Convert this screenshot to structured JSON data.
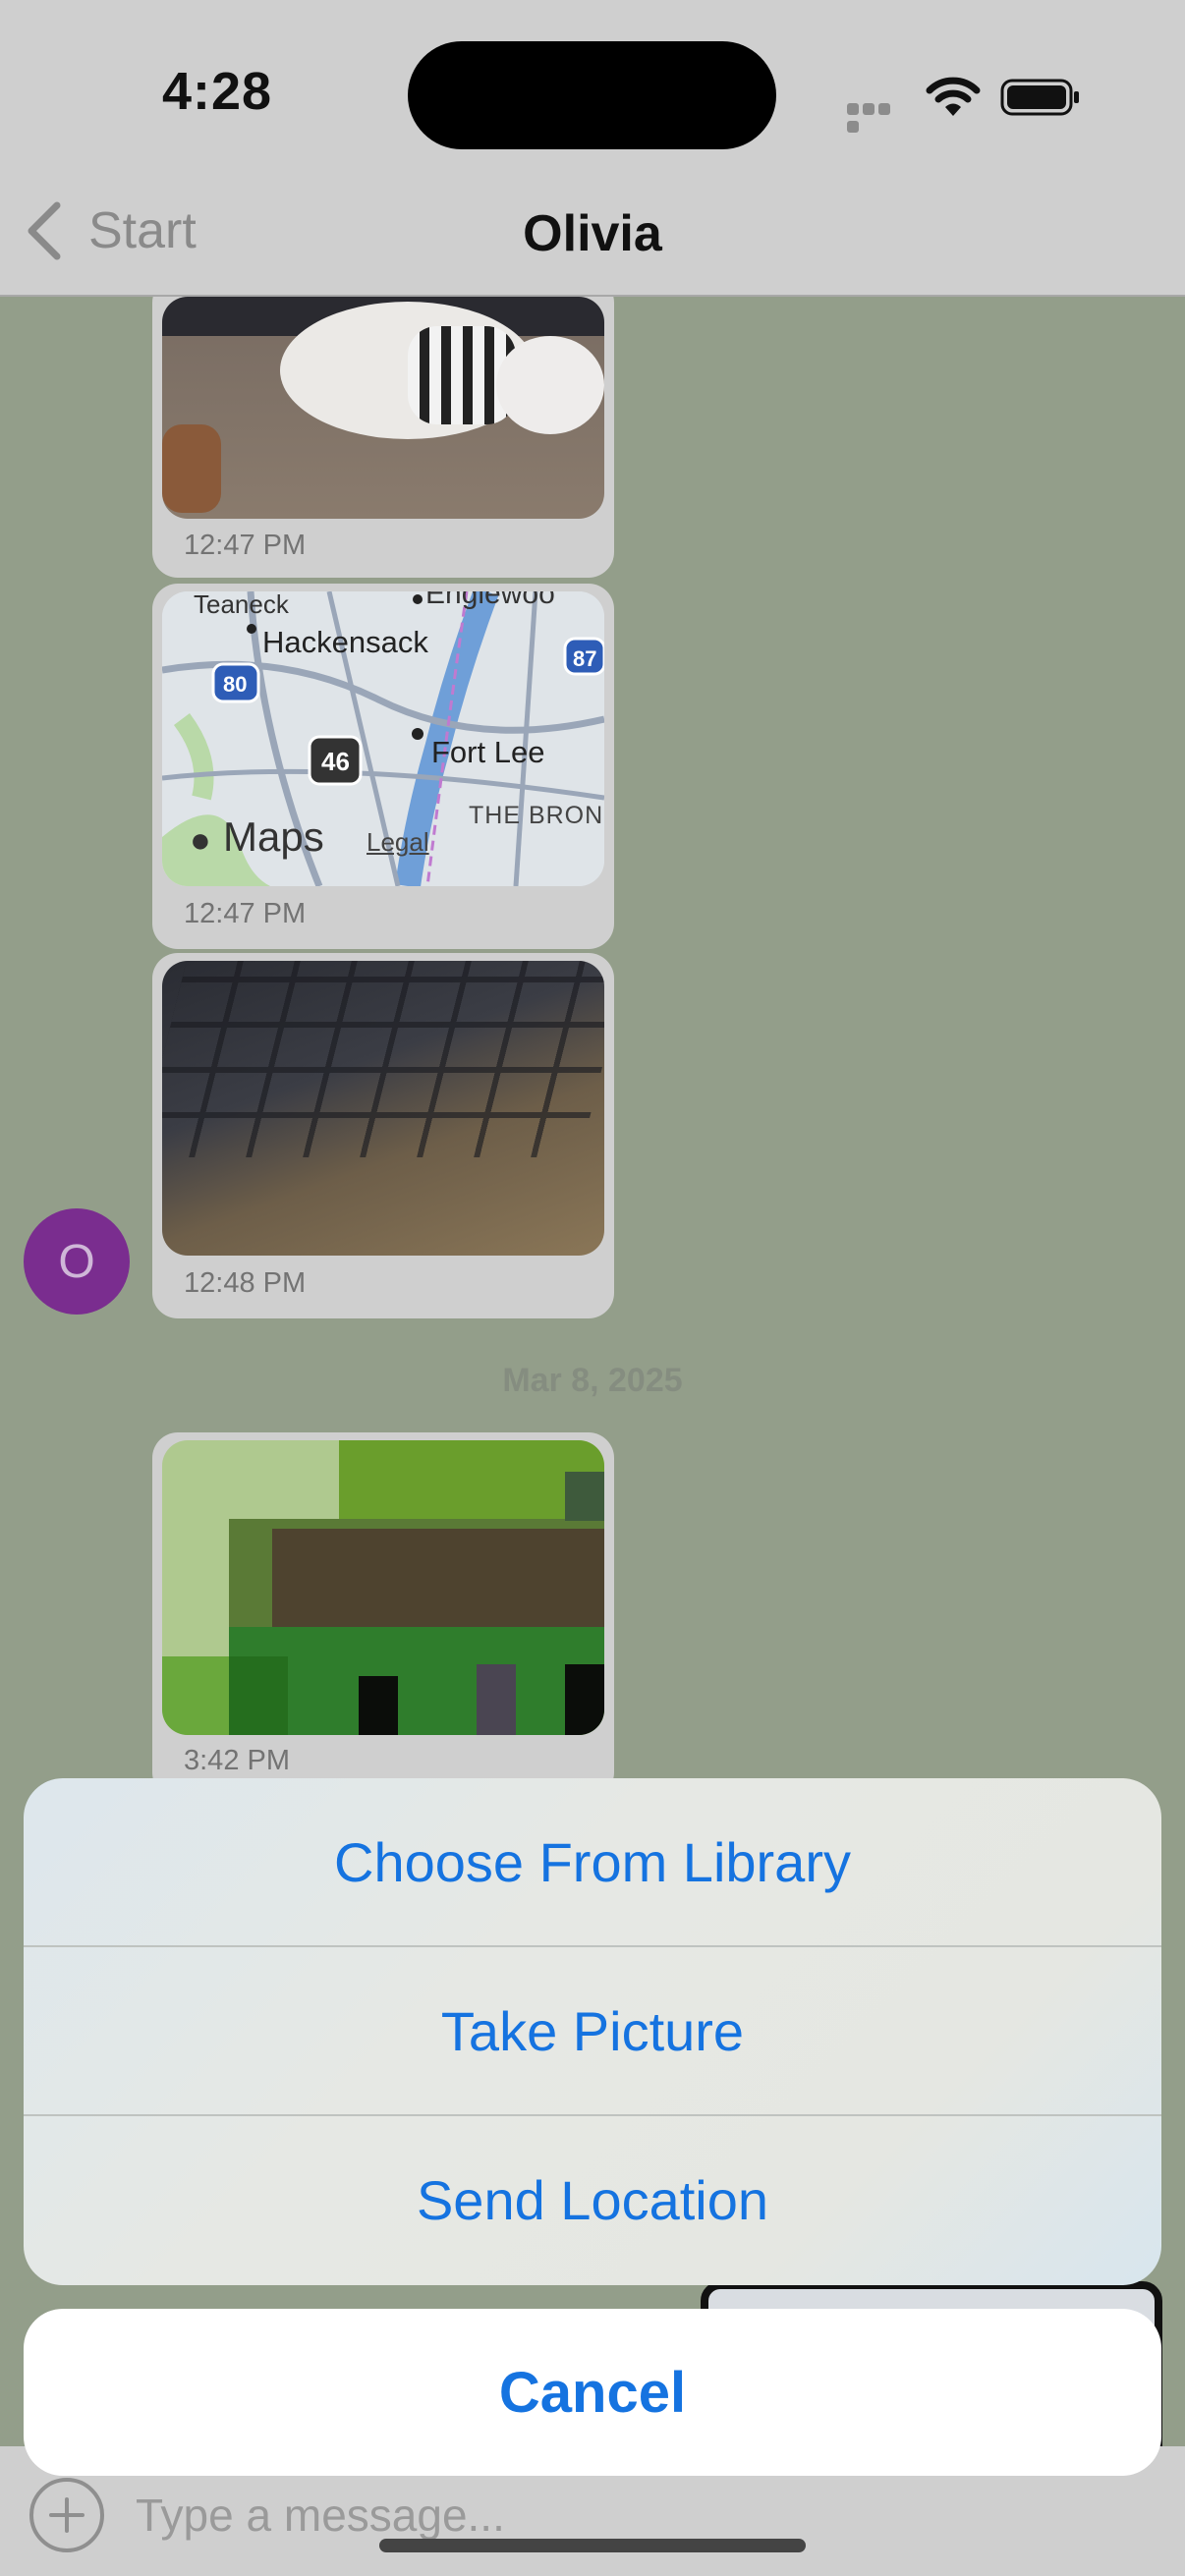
{
  "status_bar": {
    "time": "4:28"
  },
  "nav": {
    "back_label": "Start",
    "title": "Olivia"
  },
  "messages": [
    {
      "kind": "photo",
      "subject": "white-dog",
      "time": "12:47 PM"
    },
    {
      "kind": "map",
      "time": "12:47 PM",
      "map_labels": {
        "teaneck": "Teaneck",
        "englewood": "Englewoo",
        "hackensack": "Hackensack",
        "fort_lee": "Fort Lee",
        "bronx": "THE BRON",
        "route_80": "80",
        "route_46": "46",
        "route_87": "87",
        "brand": "Maps",
        "legal": "Legal"
      }
    },
    {
      "kind": "photo",
      "subject": "keyboard",
      "time": "12:48 PM"
    },
    {
      "kind": "photo",
      "subject": "pixel-art",
      "time": "3:42 PM"
    }
  ],
  "avatar": {
    "initial": "O",
    "color": "#7a2d8f"
  },
  "date_divider": "Mar 8, 2025",
  "action_sheet": {
    "options": [
      "Choose From Library",
      "Take Picture",
      "Send Location"
    ],
    "cancel": "Cancel"
  },
  "input": {
    "placeholder": "Type a message..."
  },
  "colors": {
    "accent": "#1573e0",
    "bubble": "#cfcfcf",
    "dim_background": "#939e8a"
  }
}
